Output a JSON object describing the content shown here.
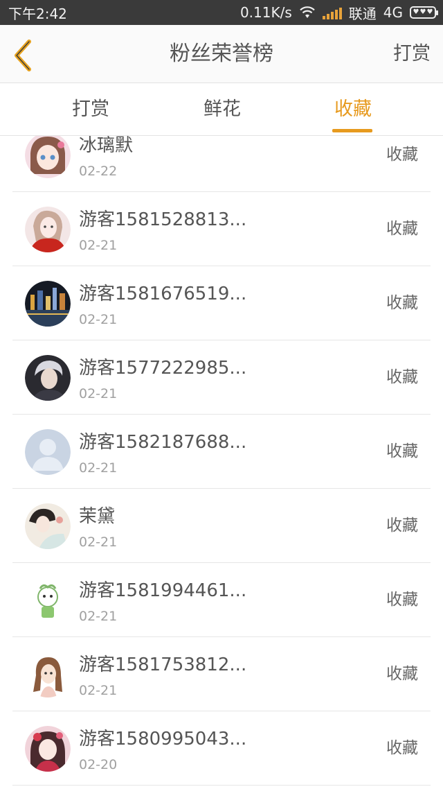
{
  "status_bar": {
    "time": "下午2:42",
    "speed": "0.11K/s",
    "carrier": "联通",
    "network": "4G",
    "icons": [
      "wifi-icon",
      "signal-icon",
      "battery-icon"
    ]
  },
  "header": {
    "title": "粉丝荣誉榜",
    "action_label": "打赏",
    "back_icon": "chevron-left-icon",
    "accent_color": "#e7a21f"
  },
  "tabs": [
    {
      "label": "打赏",
      "active": false
    },
    {
      "label": "鲜花",
      "active": false
    },
    {
      "label": "收藏",
      "active": true
    }
  ],
  "tab_active_color": "#e79a1e",
  "fans": [
    {
      "name": "冰璃默",
      "date": "02-22",
      "action": "收藏",
      "avatar": "anime-girl-pink-avatar"
    },
    {
      "name": "游客1581528813...",
      "date": "02-21",
      "action": "收藏",
      "avatar": "girl-red-dress-avatar"
    },
    {
      "name": "游客1581676519...",
      "date": "02-21",
      "action": "收藏",
      "avatar": "city-night-avatar"
    },
    {
      "name": "游客1577222985...",
      "date": "02-21",
      "action": "收藏",
      "avatar": "dark-portrait-avatar"
    },
    {
      "name": "游客1582187688...",
      "date": "02-21",
      "action": "收藏",
      "avatar": "default-user-avatar"
    },
    {
      "name": "茉黛",
      "date": "02-21",
      "action": "收藏",
      "avatar": "illustrated-woman-avatar"
    },
    {
      "name": "游客1581994461...",
      "date": "02-21",
      "action": "收藏",
      "avatar": "cartoon-character-avatar"
    },
    {
      "name": "游客1581753812...",
      "date": "02-21",
      "action": "收藏",
      "avatar": "brunette-girl-avatar"
    },
    {
      "name": "游客1580995043...",
      "date": "02-20",
      "action": "收藏",
      "avatar": "anime-girl-red-avatar"
    }
  ]
}
